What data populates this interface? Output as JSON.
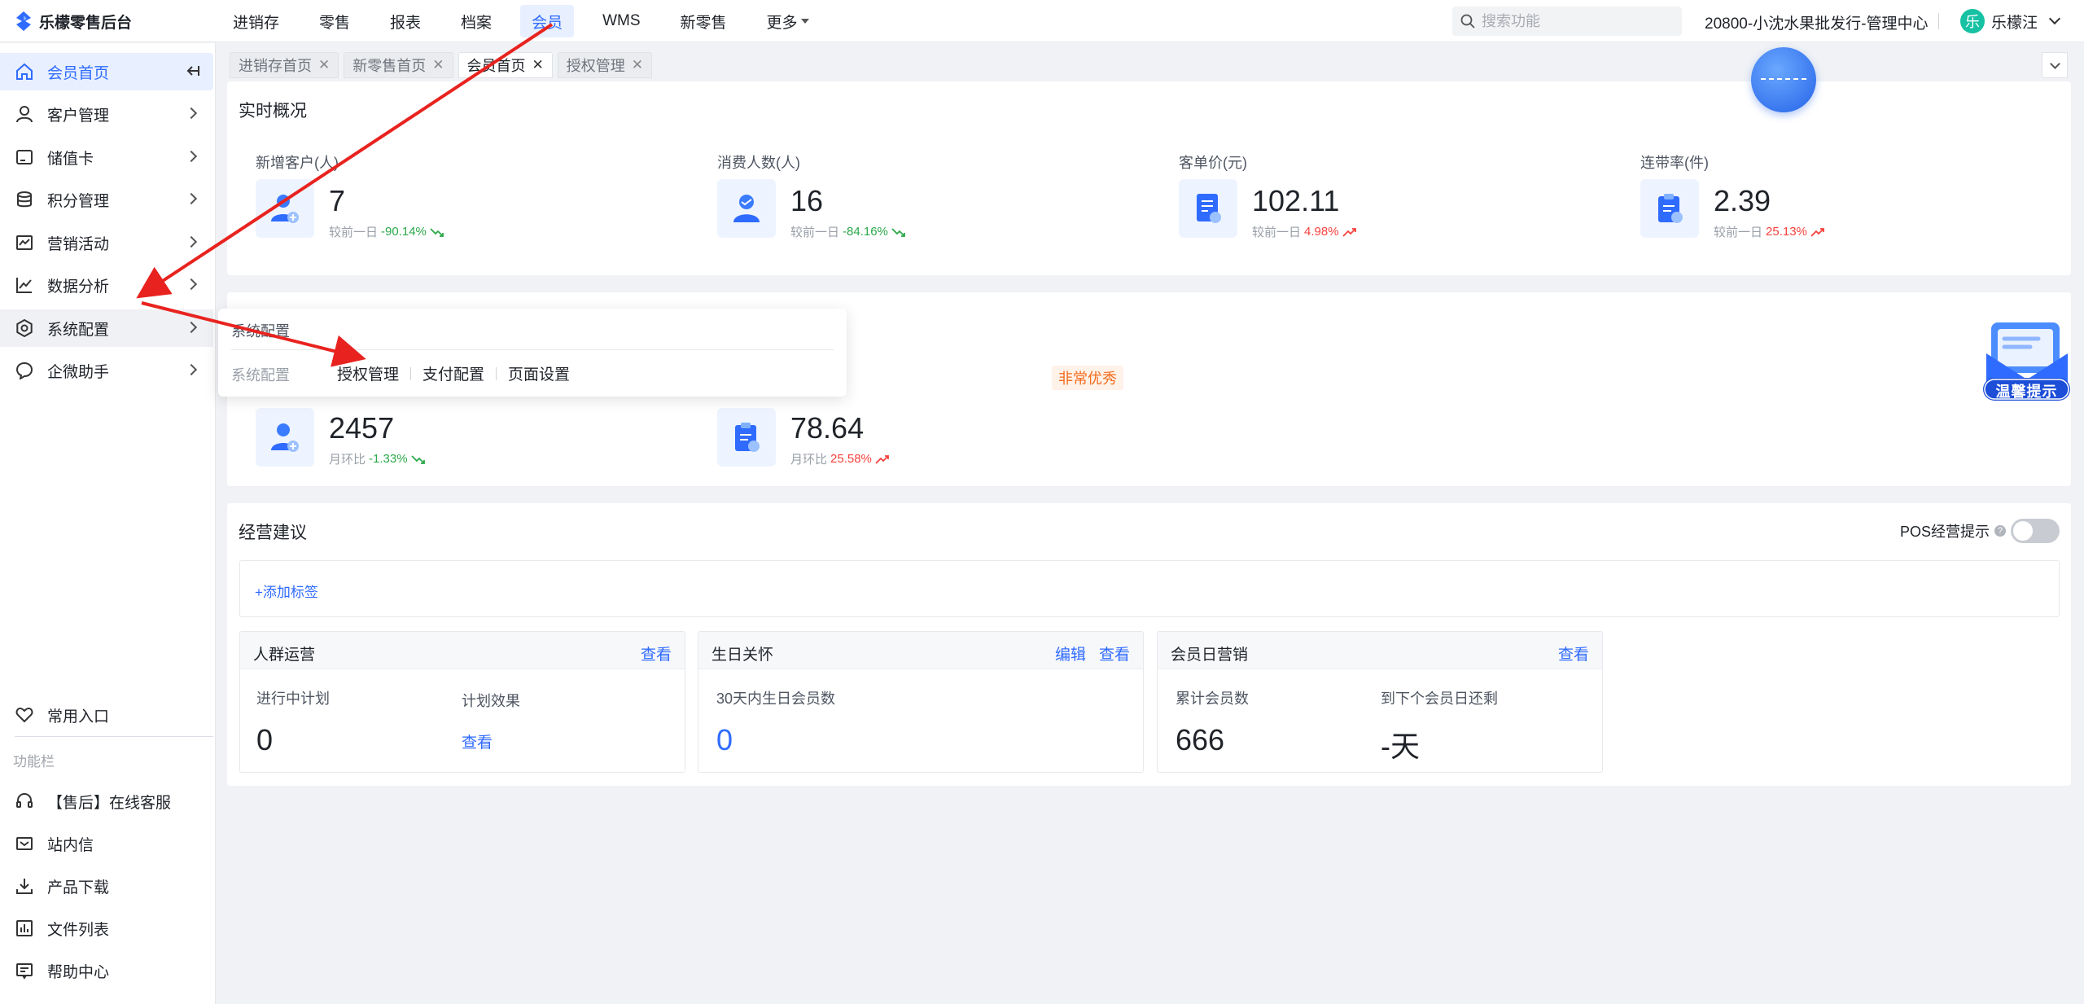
{
  "app": {
    "logo_text": "乐檬零售后台"
  },
  "top_nav": {
    "items": [
      "进销存",
      "零售",
      "报表",
      "档案",
      "会员",
      "WMS",
      "新零售"
    ],
    "more_label": "更多",
    "active": "会员"
  },
  "search": {
    "placeholder": "搜索功能"
  },
  "org_name": "20800-小沈水果批发行-管理中心",
  "user": {
    "avatar_char": "乐",
    "name": "乐檬汪"
  },
  "sidebar": {
    "items": [
      "会员首页",
      "客户管理",
      "储值卡",
      "积分管理",
      "营销活动",
      "数据分析",
      "系统配置",
      "企微助手"
    ],
    "favorites_label": "常用入口",
    "function_bar_label": "功能栏",
    "bottom_items": [
      "【售后】在线客服",
      "站内信",
      "产品下载",
      "文件列表",
      "帮助中心"
    ]
  },
  "tabs": [
    {
      "label": "进销存首页",
      "active": false
    },
    {
      "label": "新零售首页",
      "active": false
    },
    {
      "label": "会员首页",
      "active": true
    },
    {
      "label": "授权管理",
      "active": false
    }
  ],
  "realtime": {
    "title": "实时概况",
    "stats": [
      {
        "label": "新增客户(人)",
        "value": "7",
        "compare_label": "较前一日",
        "change": "-90.14%",
        "trend": "down"
      },
      {
        "label": "消费人数(人)",
        "value": "16",
        "compare_label": "较前一日",
        "change": "-84.16%",
        "trend": "down"
      },
      {
        "label": "客单价(元)",
        "value": "102.11",
        "compare_label": "较前一日",
        "change": "4.98%",
        "trend": "up"
      },
      {
        "label": "连带率(件)",
        "value": "2.39",
        "compare_label": "较前一日",
        "change": "25.13%",
        "trend": "up"
      }
    ]
  },
  "monthly": {
    "badge": "非常优秀",
    "stats": [
      {
        "value": "2457",
        "compare_label": "月环比",
        "change": "-1.33%",
        "trend": "down"
      },
      {
        "value": "78.64",
        "compare_label": "月环比",
        "change": "25.58%",
        "trend": "up"
      }
    ]
  },
  "popup": {
    "title": "系统配置",
    "group_label": "系统配置",
    "links": [
      "授权管理",
      "支付配置",
      "页面设置"
    ]
  },
  "suggestions": {
    "title": "经营建议",
    "pos_toggle_label": "POS经营提示",
    "pos_toggle_on": false,
    "add_tag_label": "+添加标签",
    "cards": {
      "crowd": {
        "title": "人群运营",
        "view_link": "查看",
        "running_label": "进行中计划",
        "running_value": "0",
        "effect_label": "计划效果",
        "effect_link": "查看"
      },
      "birthday": {
        "title": "生日关怀",
        "edit_link": "编辑",
        "view_link": "查看",
        "label": "30天内生日会员数",
        "value": "0"
      },
      "member_day": {
        "title": "会员日营销",
        "view_link": "查看",
        "total_label": "累计会员数",
        "total_value": "666",
        "next_label": "到下个会员日还剩",
        "next_value": "-天"
      }
    }
  },
  "widgets": {
    "tip_label": "温馨提示"
  },
  "colors": {
    "accent": "#2f6bff",
    "annotation_arrow": "#e8231f",
    "positive": "#2ba84a",
    "negative": "#f5413d"
  }
}
